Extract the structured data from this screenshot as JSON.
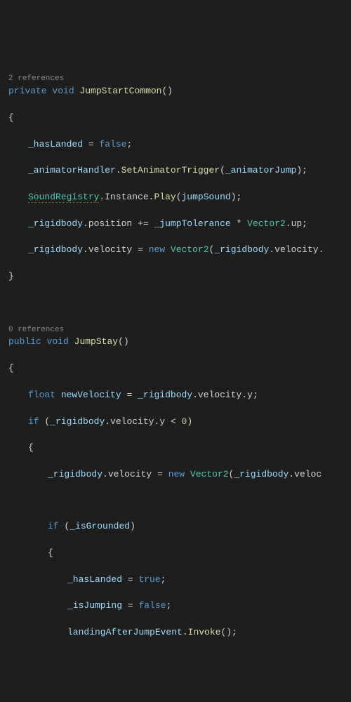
{
  "refs1": "2 references",
  "refs2": "0 references",
  "m1": {
    "mod": "private",
    "ret": "void",
    "name": "JumpStartCommon",
    "l1a": "_hasLanded",
    "l1b": "false",
    "l2a": "_animatorHandler",
    "l2b": "SetAnimatorTrigger",
    "l2c": "_animatorJump",
    "l3a": "SoundRegistry",
    "l3b": "Instance",
    "l3c": "Play",
    "l3d": "jumpSound",
    "l4a": "_rigidbody",
    "l4b": "position",
    "l4c": "_jumpTolerance",
    "l4d": "Vector2",
    "l4e": "up",
    "l5a": "_rigidbody",
    "l5b": "velocity",
    "l5c": "new",
    "l5d": "Vector2",
    "l5e": "_rigidbody",
    "l5f": "velocity"
  },
  "m2": {
    "mod": "public",
    "ret": "void",
    "name": "JumpStay",
    "l1a": "float",
    "l1b": "newVelocity",
    "l1c": "_rigidbody",
    "l1d": "velocity",
    "l1e": "y",
    "l2a": "if",
    "l2b": "_rigidbody",
    "l2c": "velocity",
    "l2d": "y",
    "l2e": "0",
    "l3a": "_rigidbody",
    "l3b": "velocity",
    "l3c": "new",
    "l3d": "Vector2",
    "l3e": "_rigidbody",
    "l3f": "veloc",
    "l4a": "if",
    "l4b": "_isGrounded",
    "l5a": "_hasLanded",
    "l5b": "true",
    "l6a": "_isJumping",
    "l6b": "false",
    "l7a": "landingAfterJumpEvent",
    "l7b": "Invoke"
  }
}
